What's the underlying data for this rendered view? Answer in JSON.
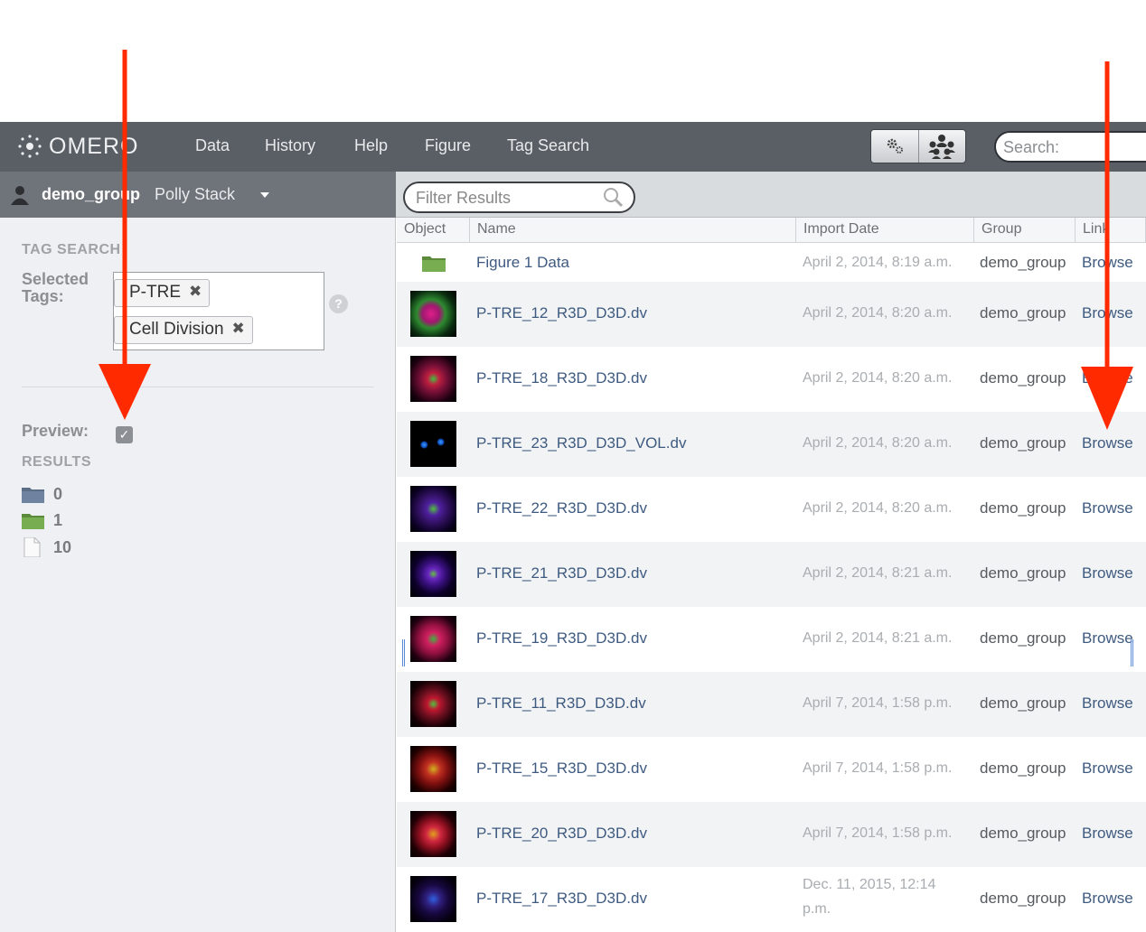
{
  "navbar": {
    "logo_text": "OMERO",
    "items": [
      "Data",
      "History",
      "Help",
      "Figure",
      "Tag Search"
    ],
    "search_placeholder": "Search:"
  },
  "user_bar": {
    "group": "demo_group",
    "user": "Polly Stack"
  },
  "filter": {
    "placeholder": "Filter Results"
  },
  "tag_search": {
    "heading": "TAG SEARCH",
    "selected_tags_label": "Selected Tags:",
    "tags": [
      "P-TRE",
      "Cell Division"
    ],
    "help_label": "?",
    "preview_label": "Preview:",
    "preview_checked": true,
    "results_heading": "RESULTS",
    "results": [
      {
        "icon": "project-folder-icon",
        "count": "0"
      },
      {
        "icon": "dataset-folder-icon",
        "count": "1"
      },
      {
        "icon": "image-file-icon",
        "count": "10"
      }
    ]
  },
  "table": {
    "columns": [
      "Object",
      "Name",
      "Import Date",
      "Group",
      "Link"
    ],
    "rows": [
      {
        "object": "folder",
        "name": "Figure 1 Data",
        "date": "April 2, 2014, 8:19 a.m.",
        "group": "demo_group",
        "link": "Browse"
      },
      {
        "object": "image",
        "name": "P-TRE_12_R3D_D3D.dv",
        "date": "April 2, 2014, 8:20 a.m.",
        "group": "demo_group",
        "link": "Browse",
        "thumb": "green-magenta"
      },
      {
        "object": "image",
        "name": "P-TRE_18_R3D_D3D.dv",
        "date": "April 2, 2014, 8:20 a.m.",
        "group": "demo_group",
        "link": "Browse",
        "thumb": "red-blue"
      },
      {
        "object": "image",
        "name": "P-TRE_23_R3D_D3D_VOL.dv",
        "date": "April 2, 2014, 8:20 a.m.",
        "group": "demo_group",
        "link": "Browse",
        "thumb": "blue-dots"
      },
      {
        "object": "image",
        "name": "P-TRE_22_R3D_D3D.dv",
        "date": "April 2, 2014, 8:20 a.m.",
        "group": "demo_group",
        "link": "Browse",
        "thumb": "purple-green"
      },
      {
        "object": "image",
        "name": "P-TRE_21_R3D_D3D.dv",
        "date": "April 2, 2014, 8:21 a.m.",
        "group": "demo_group",
        "link": "Browse",
        "thumb": "violet"
      },
      {
        "object": "image",
        "name": "P-TRE_19_R3D_D3D.dv",
        "date": "April 2, 2014, 8:21 a.m.",
        "group": "demo_group",
        "link": "Browse",
        "thumb": "red-magenta"
      },
      {
        "object": "image",
        "name": "P-TRE_11_R3D_D3D.dv",
        "date": "April 7, 2014, 1:58 p.m.",
        "group": "demo_group",
        "link": "Browse",
        "thumb": "red-spindle"
      },
      {
        "object": "image",
        "name": "P-TRE_15_R3D_D3D.dv",
        "date": "April 7, 2014, 1:58 p.m.",
        "group": "demo_group",
        "link": "Browse",
        "thumb": "red-yellow"
      },
      {
        "object": "image",
        "name": "P-TRE_20_R3D_D3D.dv",
        "date": "April 7, 2014, 1:58 p.m.",
        "group": "demo_group",
        "link": "Browse",
        "thumb": "red-round"
      },
      {
        "object": "image",
        "name": "P-TRE_17_R3D_D3D.dv",
        "date": "Dec. 11, 2015, 12:14 p.m.",
        "group": "demo_group",
        "link": "Browse",
        "thumb": "dark-blue"
      }
    ]
  },
  "colors": {
    "navbar": "#5a5e65",
    "annotation_arrow": "#ff2a00",
    "link": "#3e5a80"
  }
}
